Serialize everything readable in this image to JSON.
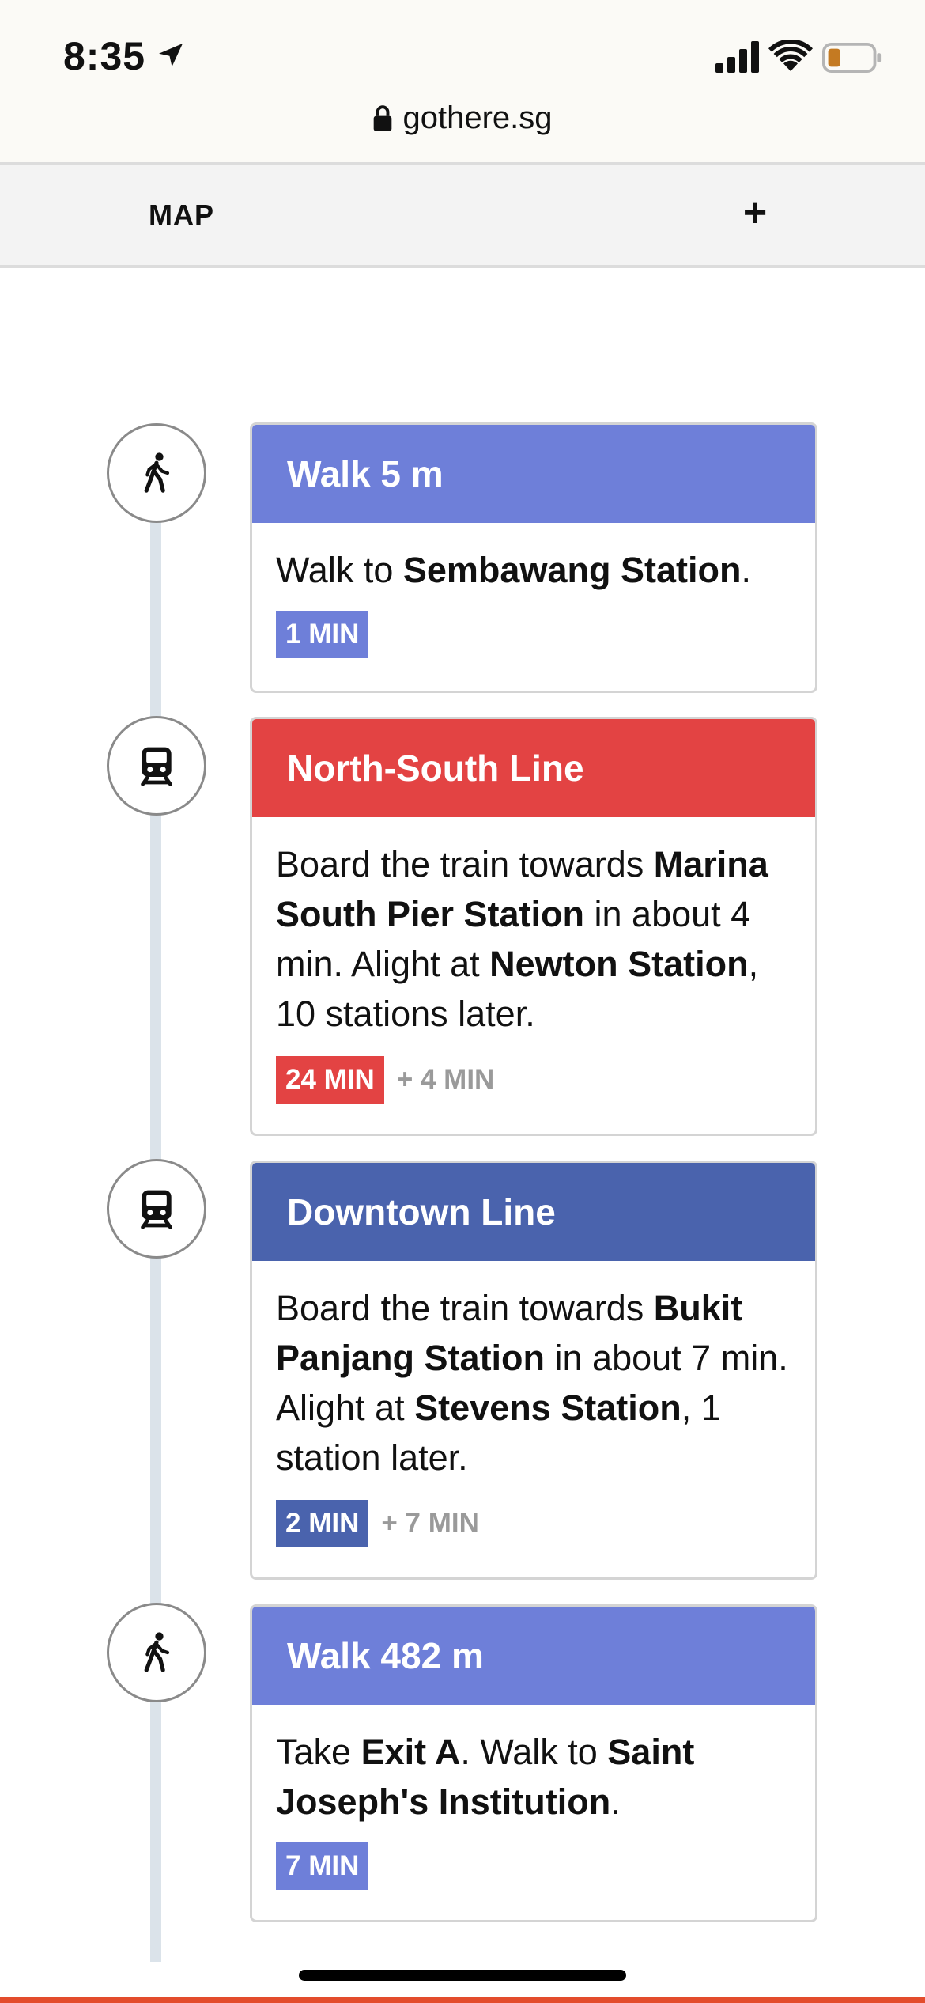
{
  "status_bar": {
    "time": "8:35",
    "icons": [
      "location-arrow-icon",
      "cellular-signal-icon",
      "wifi-icon",
      "battery-low-icon"
    ]
  },
  "browser": {
    "url": "gothere.sg"
  },
  "mapbar": {
    "label": "MAP",
    "plus_label": "+"
  },
  "steps": [
    {
      "mode": "walk",
      "icon": "walk-icon",
      "color": "#6e7fd9",
      "title": "Walk 5 m",
      "body": [
        {
          "t": "Walk to "
        },
        {
          "t": "Sembawang Station",
          "b": true
        },
        {
          "t": "."
        }
      ],
      "duration": "1 MIN",
      "wait": ""
    },
    {
      "mode": "train",
      "icon": "train-icon",
      "color": "#e34343",
      "title": "North-South Line",
      "body": [
        {
          "t": "Board the train towards "
        },
        {
          "t": "Marina South Pier Station",
          "b": true
        },
        {
          "t": " in about 4 min. Alight at "
        },
        {
          "t": "Newton Station",
          "b": true
        },
        {
          "t": ", 10 stations later."
        }
      ],
      "duration": "24 MIN",
      "wait": "+ 4 MIN"
    },
    {
      "mode": "train",
      "icon": "train-icon",
      "color": "#4a63ad",
      "title": "Downtown Line",
      "body": [
        {
          "t": "Board the train towards "
        },
        {
          "t": "Bukit Panjang Station",
          "b": true
        },
        {
          "t": " in about 7 min. Alight at "
        },
        {
          "t": "Stevens Station",
          "b": true
        },
        {
          "t": ", 1 station later."
        }
      ],
      "duration": "2 MIN",
      "wait": "+ 7 MIN"
    },
    {
      "mode": "walk",
      "icon": "walk-icon",
      "color": "#6e7fd9",
      "title": "Walk 482 m",
      "body": [
        {
          "t": "Take "
        },
        {
          "t": "Exit A",
          "b": true
        },
        {
          "t": ". Walk to "
        },
        {
          "t": "Saint Joseph's Institution",
          "b": true
        },
        {
          "t": "."
        }
      ],
      "duration": "7 MIN",
      "wait": ""
    }
  ]
}
